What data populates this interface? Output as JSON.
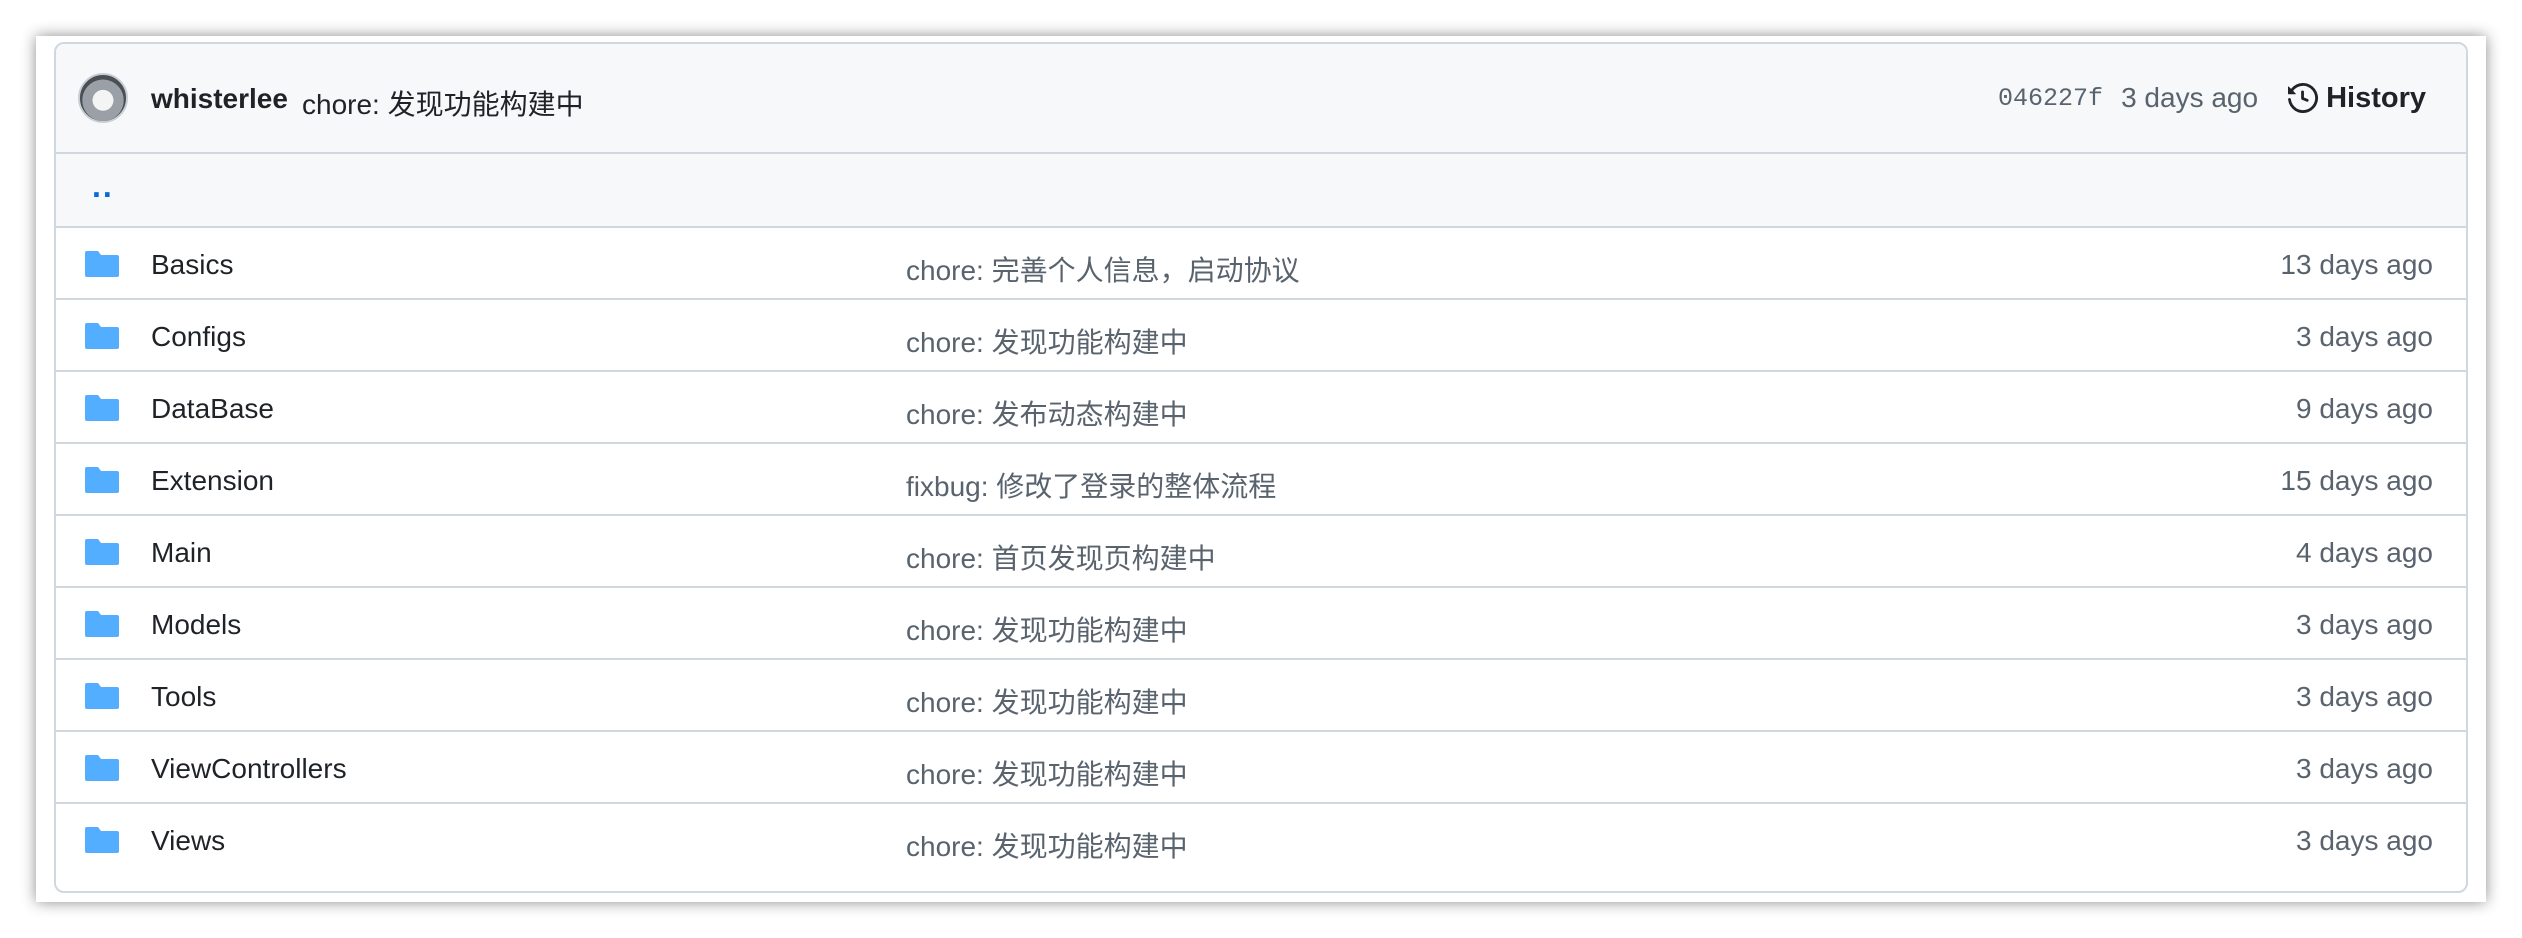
{
  "commit": {
    "author": "whisterlee",
    "message": "chore: 发现功能构建中",
    "sha": "046227f",
    "time": "3 days ago",
    "history_label": "History"
  },
  "parent_dir_label": "..",
  "colors": {
    "folder": "#54aeff",
    "link": "#0969da",
    "border": "#d0d7de"
  },
  "files": [
    {
      "name": "Basics",
      "message": "chore: 完善个人信息，启动协议",
      "time": "13 days ago",
      "icon": "folder-icon"
    },
    {
      "name": "Configs",
      "message": "chore: 发现功能构建中",
      "time": "3 days ago",
      "icon": "folder-icon"
    },
    {
      "name": "DataBase",
      "message": "chore: 发布动态构建中",
      "time": "9 days ago",
      "icon": "folder-icon"
    },
    {
      "name": "Extension",
      "message": "fixbug: 修改了登录的整体流程",
      "time": "15 days ago",
      "icon": "folder-icon"
    },
    {
      "name": "Main",
      "message": "chore: 首页发现页构建中",
      "time": "4 days ago",
      "icon": "folder-icon"
    },
    {
      "name": "Models",
      "message": "chore: 发现功能构建中",
      "time": "3 days ago",
      "icon": "folder-icon"
    },
    {
      "name": "Tools",
      "message": "chore: 发现功能构建中",
      "time": "3 days ago",
      "icon": "folder-icon"
    },
    {
      "name": "ViewControllers",
      "message": "chore: 发现功能构建中",
      "time": "3 days ago",
      "icon": "folder-icon"
    },
    {
      "name": "Views",
      "message": "chore: 发现功能构建中",
      "time": "3 days ago",
      "icon": "folder-icon"
    }
  ]
}
